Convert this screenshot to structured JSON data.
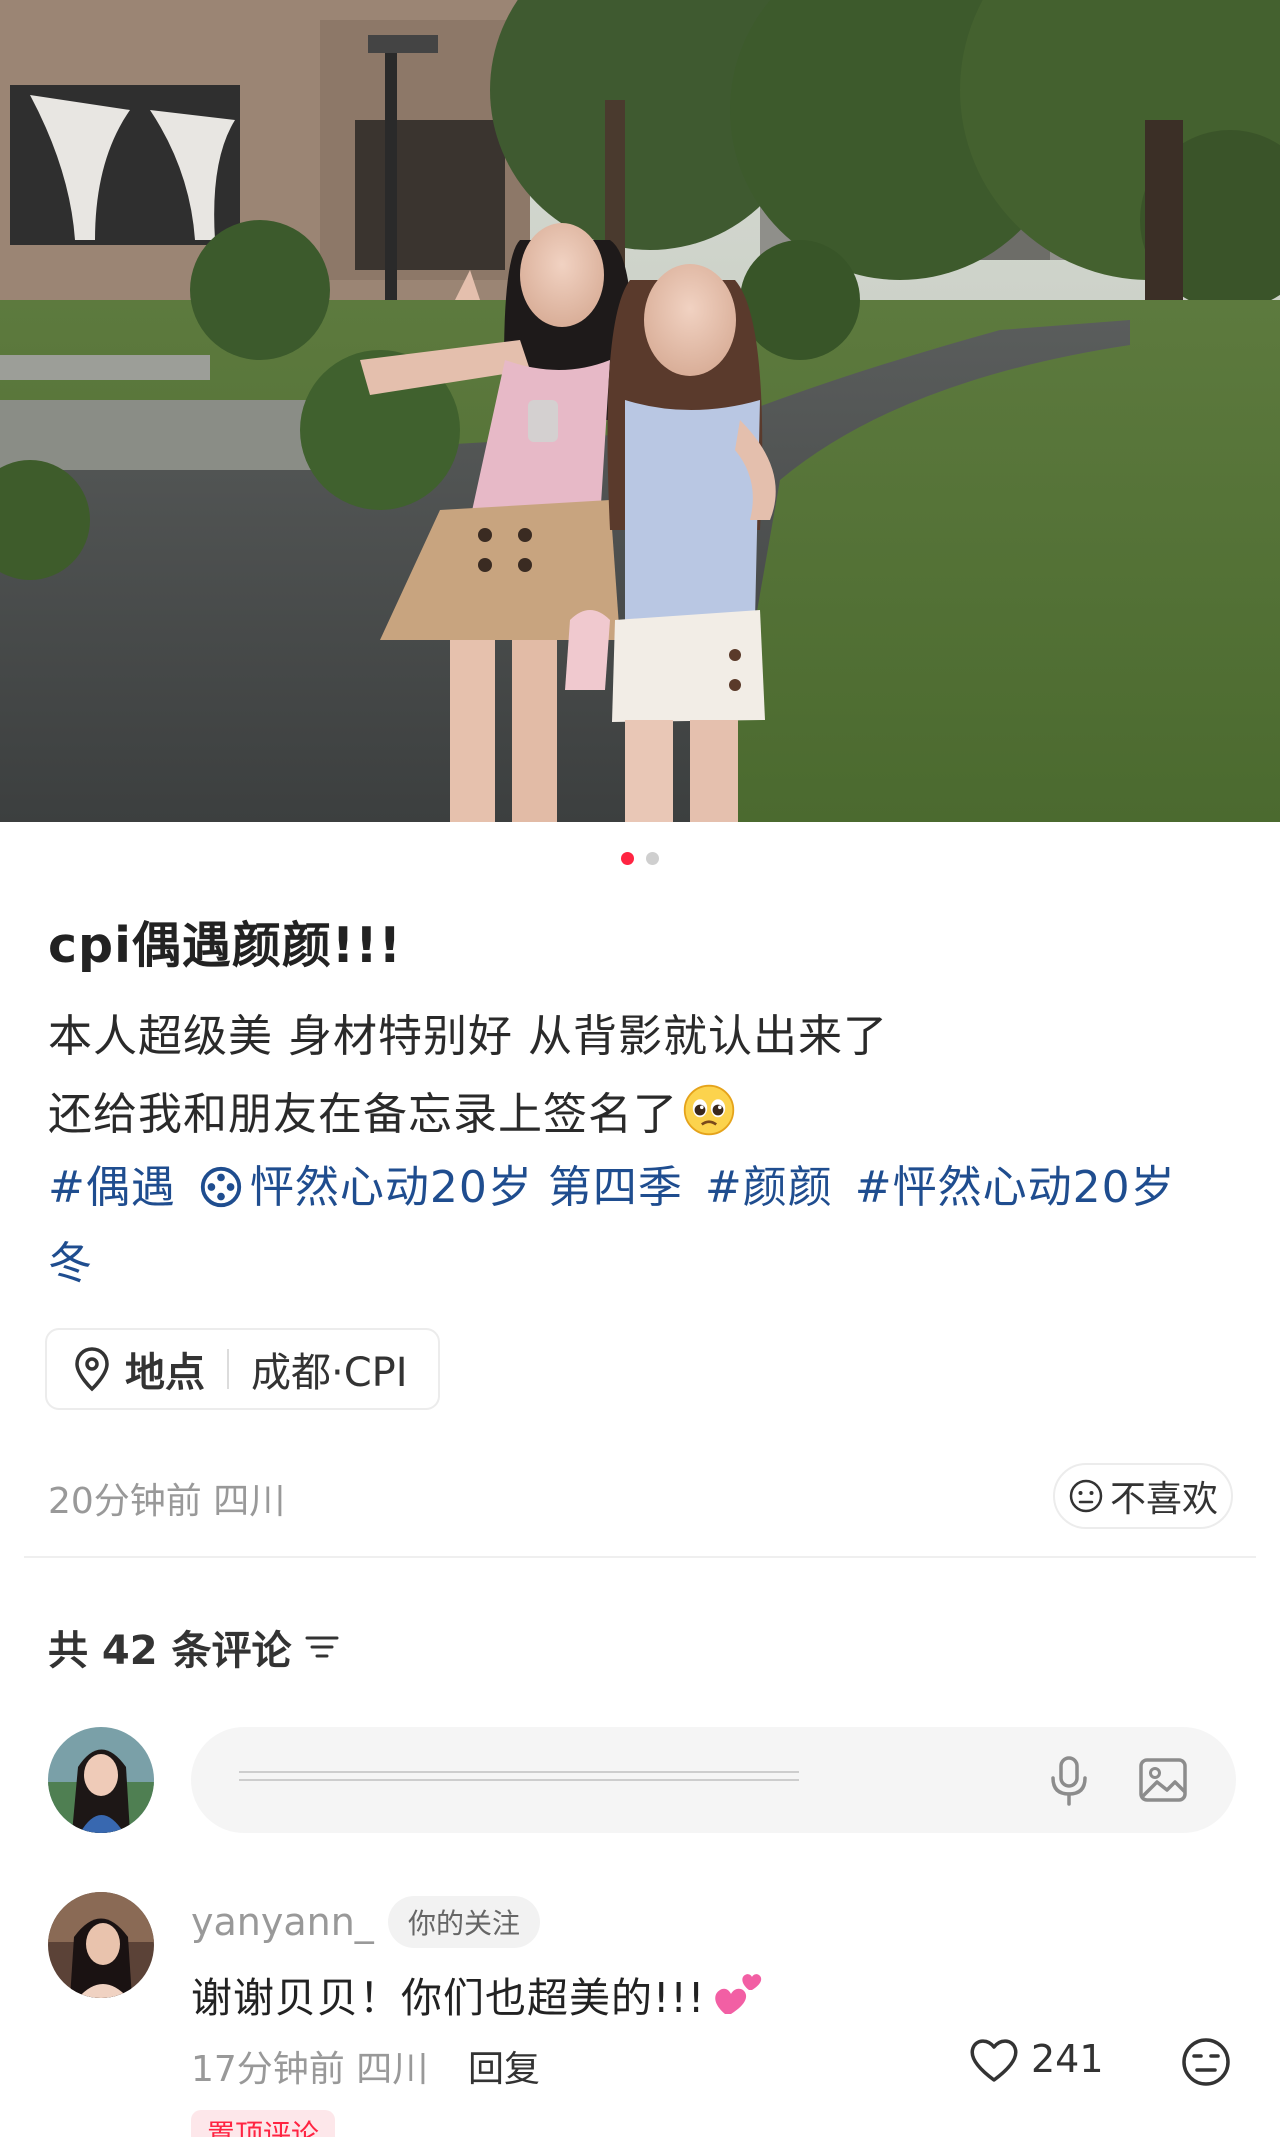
{
  "post": {
    "image_count": 2,
    "active_image": 1,
    "title": "cpi偶遇颜颜!!!",
    "body_line1": "本人超级美 身材特别好 从背影就认出来了",
    "body_line2": "还给我和朋友在备忘录上签名了",
    "body_line2_emoji": "pleading-face-emoji",
    "tags": [
      "#偶遇",
      "怦然心动20岁 第四季",
      "#颜颜",
      "#怦然心动20岁"
    ],
    "tags_wrap": "冬",
    "location_label": "地点",
    "location_value": "成都·CPI",
    "meta": "20分钟前 四川",
    "dislike_label": "不喜欢"
  },
  "comments": {
    "count_label": "共 42 条评论",
    "composer_placeholder": "",
    "items": [
      {
        "user": "yanyann_",
        "badge": "你的关注",
        "text": "谢谢贝贝！你们也超美的!!!",
        "emoji": "two-hearts-emoji",
        "time": "17分钟前 四川",
        "reply_label": "回复",
        "likes": "241",
        "pinned_label": "置顶评论"
      }
    ]
  },
  "colors": {
    "accent": "#ff2442",
    "tag": "#1f4d8f",
    "muted": "#999999"
  }
}
